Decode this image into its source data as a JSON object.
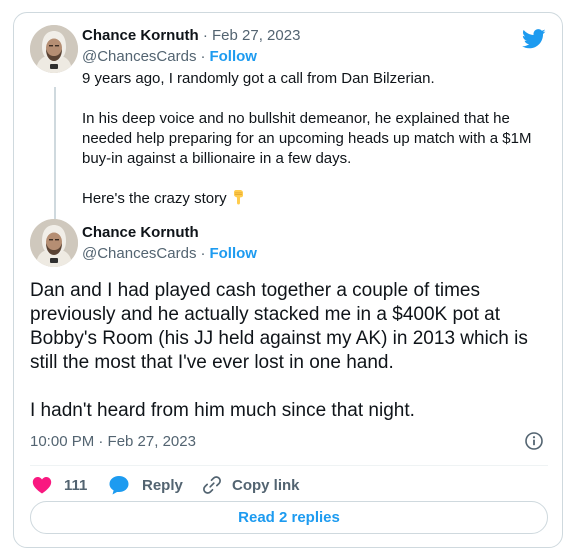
{
  "quoted_tweet": {
    "author_name": "Chance Kornuth",
    "date": "Feb 27, 2023",
    "handle": "@ChancesCards",
    "follow_label": "Follow",
    "paragraphs": [
      "9 years ago, I randomly got a call from Dan Bilzerian.",
      "In his deep voice and no bullshit demeanor, he explained that he needed help preparing for an upcoming heads up match with a $1M buy-in against a billionaire in a few days.",
      "Here's the crazy story"
    ],
    "emoji": "point-down-icon"
  },
  "main_tweet": {
    "author_name": "Chance Kornuth",
    "handle": "@ChancesCards",
    "follow_label": "Follow",
    "paragraphs": [
      "Dan and I had played cash together a couple of times previously and he actually stacked me in a $400K pot at Bobby's Room (his JJ held against my AK) in 2013 which is still the most that I've ever lost in one hand.",
      "I hadn't heard from him much since that night."
    ],
    "timestamp": "10:00 PM · Feb 27, 2023"
  },
  "actions": {
    "like_count": "111",
    "reply_label": "Reply",
    "copy_link_label": "Copy link",
    "read_replies_label": "Read 2 replies"
  },
  "colors": {
    "brand": "#1d9bf0",
    "like": "#f91880",
    "text": "#0f1419",
    "secondary": "#536471",
    "border": "#cfd9de"
  }
}
